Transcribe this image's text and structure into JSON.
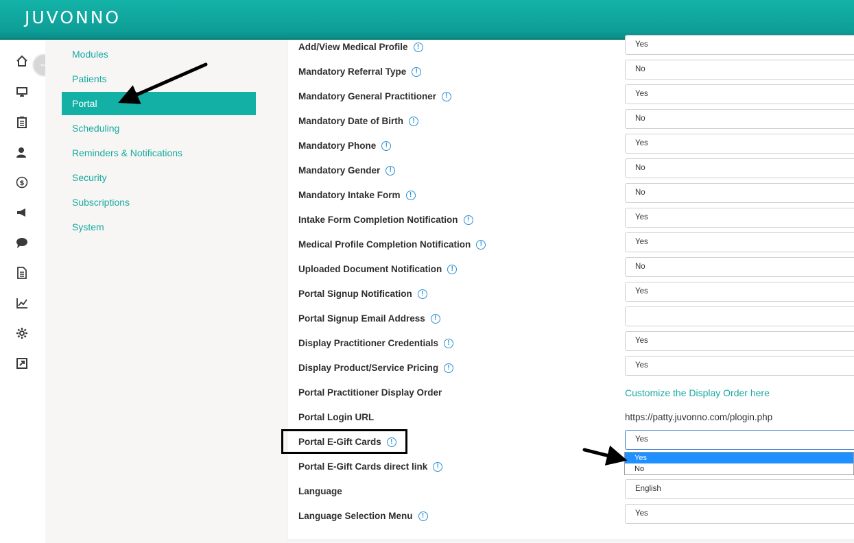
{
  "app": {
    "logo_text": "JUVONNO"
  },
  "rail_icons": [
    "home-icon",
    "monitor-icon",
    "clipboard-icon",
    "user-icon",
    "dollar-icon",
    "megaphone-icon",
    "chat-icon",
    "document-icon",
    "chart-icon",
    "gear-icon",
    "external-link-icon"
  ],
  "nav": {
    "items": [
      {
        "label": "Modules",
        "active": false
      },
      {
        "label": "Patients",
        "active": false
      },
      {
        "label": "Portal",
        "active": true
      },
      {
        "label": "Scheduling",
        "active": false
      },
      {
        "label": "Reminders & Notifications",
        "active": false
      },
      {
        "label": "Security",
        "active": false
      },
      {
        "label": "Subscriptions",
        "active": false
      },
      {
        "label": "System",
        "active": false
      }
    ]
  },
  "settings": {
    "rows": [
      {
        "label": "Add/View Medical Profile",
        "info": true,
        "type": "select",
        "value": "Yes"
      },
      {
        "label": "Mandatory Referral Type",
        "info": true,
        "type": "select",
        "value": "No"
      },
      {
        "label": "Mandatory General Practitioner",
        "info": true,
        "type": "select",
        "value": "Yes"
      },
      {
        "label": "Mandatory Date of Birth",
        "info": true,
        "type": "select",
        "value": "No"
      },
      {
        "label": "Mandatory Phone",
        "info": true,
        "type": "select",
        "value": "Yes"
      },
      {
        "label": "Mandatory Gender",
        "info": true,
        "type": "select",
        "value": "No"
      },
      {
        "label": "Mandatory Intake Form",
        "info": true,
        "type": "select",
        "value": "No"
      },
      {
        "label": "Intake Form Completion Notification",
        "info": true,
        "type": "select",
        "value": "Yes"
      },
      {
        "label": "Medical Profile Completion Notification",
        "info": true,
        "type": "select",
        "value": "Yes"
      },
      {
        "label": "Uploaded Document Notification",
        "info": true,
        "type": "select",
        "value": "No"
      },
      {
        "label": "Portal Signup Notification",
        "info": true,
        "type": "select",
        "value": "Yes"
      },
      {
        "label": "Portal Signup Email Address",
        "info": true,
        "type": "input",
        "value": ""
      },
      {
        "label": "Display Practitioner Credentials",
        "info": true,
        "type": "select",
        "value": "Yes"
      },
      {
        "label": "Display Product/Service Pricing",
        "info": true,
        "type": "select",
        "value": "Yes"
      },
      {
        "label": "Portal Practitioner Display Order",
        "info": false,
        "type": "link",
        "value": "Customize the Display Order here"
      },
      {
        "label": "Portal Login URL",
        "info": false,
        "type": "text",
        "value": "https://patty.juvonno.com/plogin.php"
      },
      {
        "label": "Portal E-Gift Cards",
        "info": true,
        "type": "select",
        "value": "Yes"
      },
      {
        "label": "Portal E-Gift Cards direct link",
        "info": true,
        "type": "none",
        "value": ""
      },
      {
        "label": "Language",
        "info": false,
        "type": "select",
        "value": "English"
      },
      {
        "label": "Language Selection Menu",
        "info": true,
        "type": "select",
        "value": "Yes"
      }
    ],
    "info_glyph": "!"
  },
  "dropdown": {
    "options": [
      "Yes",
      "No"
    ],
    "highlighted": "Yes"
  },
  "colors": {
    "brand": "#13b0a5",
    "link": "#17a9a0",
    "info": "#2a8fd1",
    "dropdown_highlight": "#1e90ff"
  }
}
